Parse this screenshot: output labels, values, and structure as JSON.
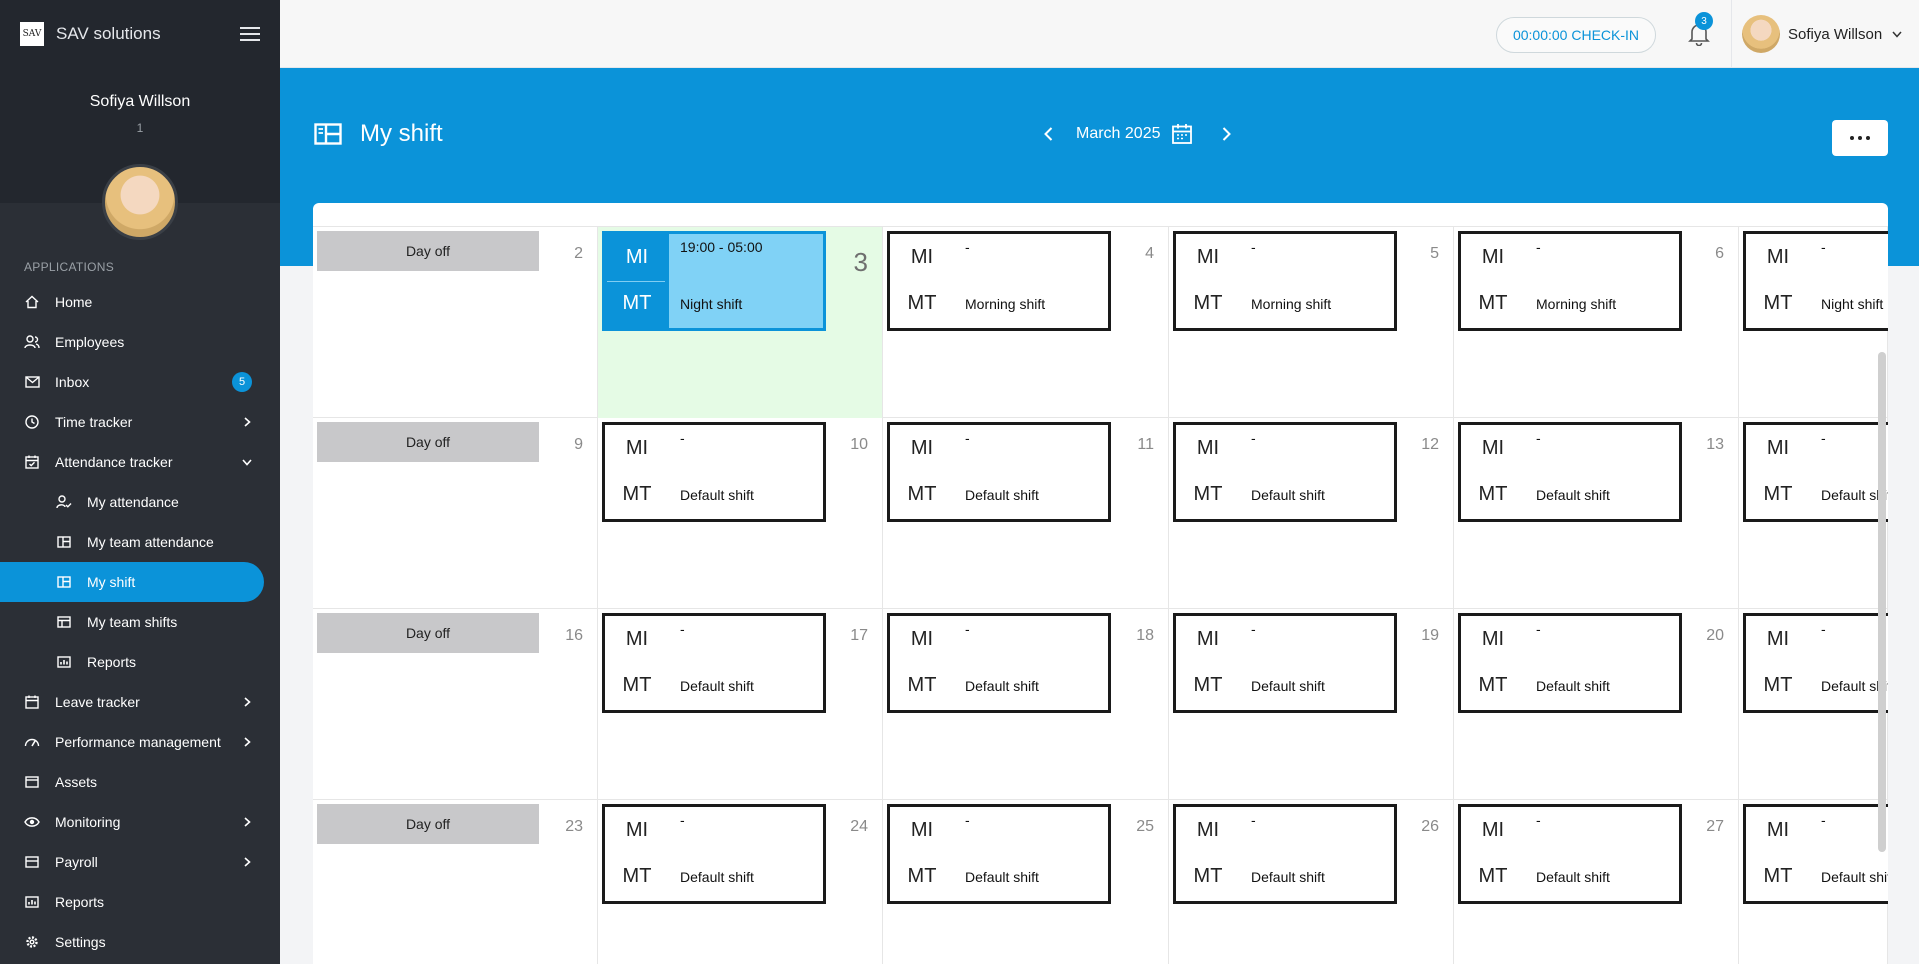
{
  "brand": {
    "name": "SAV solutions",
    "logo_text": "SAV"
  },
  "profile": {
    "name": "Sofiya Willson",
    "sub": "1"
  },
  "sidebar": {
    "section": "APPLICATIONS",
    "items": [
      {
        "label": "Home",
        "icon": "home-icon"
      },
      {
        "label": "Employees",
        "icon": "users-icon"
      },
      {
        "label": "Inbox",
        "icon": "mail-icon",
        "badge": "5"
      },
      {
        "label": "Time tracker",
        "icon": "clock-icon"
      },
      {
        "label": "Attendance tracker",
        "icon": "calendar-check-icon"
      },
      {
        "label": "My attendance",
        "icon": "user-check-icon"
      },
      {
        "label": "My team attendance",
        "icon": "layout-icon"
      },
      {
        "label": "My shift",
        "icon": "layout-icon"
      },
      {
        "label": "My team shifts",
        "icon": "table-icon"
      },
      {
        "label": "Reports",
        "icon": "chart-icon"
      },
      {
        "label": "Leave tracker",
        "icon": "calendar-icon"
      },
      {
        "label": "Performance management",
        "icon": "gauge-icon"
      },
      {
        "label": "Assets",
        "icon": "window-icon"
      },
      {
        "label": "Monitoring",
        "icon": "eye-icon"
      },
      {
        "label": "Payroll",
        "icon": "wallet-icon"
      },
      {
        "label": "Reports",
        "icon": "chart-icon"
      },
      {
        "label": "Settings",
        "icon": "gear-icon"
      }
    ]
  },
  "topbar": {
    "checkin_label": "00:00:00 CHECK-IN",
    "notifications_count": "3",
    "user_name": "Sofiya Willson"
  },
  "header": {
    "title": "My shift",
    "month": "March 2025"
  },
  "colors": {
    "accent": "#0b93d9",
    "sidebar": "#2b2f36",
    "today": "#e5fbe5",
    "day_off": "#c8c8ca",
    "night_shift": "#80d2f6"
  },
  "calendar": {
    "day_off_label": "Day off",
    "weeks": [
      {
        "days": [
          {
            "num": "2",
            "type": "off"
          },
          {
            "num": "3",
            "type": "shift",
            "mi": "MI",
            "mt": "MT",
            "time": "19:00 - 05:00",
            "shift": "Night shift",
            "today": true,
            "night": true
          },
          {
            "num": "4",
            "type": "shift",
            "mi": "MI",
            "mt": "MT",
            "time": "-",
            "shift": "Morning shift"
          },
          {
            "num": "5",
            "type": "shift",
            "mi": "MI",
            "mt": "MT",
            "time": "-",
            "shift": "Morning shift"
          },
          {
            "num": "6",
            "type": "shift",
            "mi": "MI",
            "mt": "MT",
            "time": "-",
            "shift": "Morning shift"
          },
          {
            "num": "",
            "type": "shift",
            "mi": "MI",
            "mt": "MT",
            "time": "-",
            "shift": "Night shift"
          }
        ]
      },
      {
        "days": [
          {
            "num": "9",
            "type": "off"
          },
          {
            "num": "10",
            "type": "shift",
            "mi": "MI",
            "mt": "MT",
            "time": "-",
            "shift": "Default shift"
          },
          {
            "num": "11",
            "type": "shift",
            "mi": "MI",
            "mt": "MT",
            "time": "-",
            "shift": "Default shift"
          },
          {
            "num": "12",
            "type": "shift",
            "mi": "MI",
            "mt": "MT",
            "time": "-",
            "shift": "Default shift"
          },
          {
            "num": "13",
            "type": "shift",
            "mi": "MI",
            "mt": "MT",
            "time": "-",
            "shift": "Default shift"
          },
          {
            "num": "",
            "type": "shift",
            "mi": "MI",
            "mt": "MT",
            "time": "-",
            "shift": "Default shift"
          }
        ]
      },
      {
        "days": [
          {
            "num": "16",
            "type": "off"
          },
          {
            "num": "17",
            "type": "shift",
            "mi": "MI",
            "mt": "MT",
            "time": "-",
            "shift": "Default shift"
          },
          {
            "num": "18",
            "type": "shift",
            "mi": "MI",
            "mt": "MT",
            "time": "-",
            "shift": "Default shift"
          },
          {
            "num": "19",
            "type": "shift",
            "mi": "MI",
            "mt": "MT",
            "time": "-",
            "shift": "Default shift"
          },
          {
            "num": "20",
            "type": "shift",
            "mi": "MI",
            "mt": "MT",
            "time": "-",
            "shift": "Default shift"
          },
          {
            "num": "",
            "type": "shift",
            "mi": "MI",
            "mt": "MT",
            "time": "-",
            "shift": "Default shift"
          }
        ]
      },
      {
        "days": [
          {
            "num": "23",
            "type": "off"
          },
          {
            "num": "24",
            "type": "shift",
            "mi": "MI",
            "mt": "MT",
            "time": "-",
            "shift": "Default shift"
          },
          {
            "num": "25",
            "type": "shift",
            "mi": "MI",
            "mt": "MT",
            "time": "-",
            "shift": "Default shift"
          },
          {
            "num": "26",
            "type": "shift",
            "mi": "MI",
            "mt": "MT",
            "time": "-",
            "shift": "Default shift"
          },
          {
            "num": "27",
            "type": "shift",
            "mi": "MI",
            "mt": "MT",
            "time": "-",
            "shift": "Default shift"
          },
          {
            "num": "",
            "type": "shift",
            "mi": "MI",
            "mt": "MT",
            "time": "-",
            "shift": "Default shift"
          }
        ]
      }
    ]
  }
}
